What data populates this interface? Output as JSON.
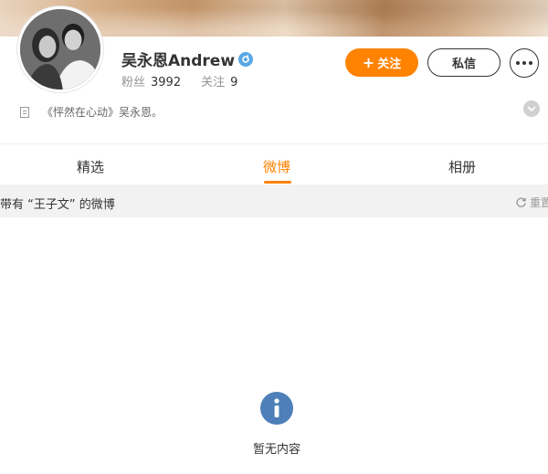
{
  "profile": {
    "name": "吴永恩Andrew",
    "followers_label": "粉丝",
    "followers_count": "3992",
    "following_label": "关注",
    "following_count": "9",
    "bio": "《怦然在心动》吴永恩。"
  },
  "actions": {
    "follow_label": "关注",
    "message_label": "私信"
  },
  "tabs": [
    {
      "label": "精选"
    },
    {
      "label": "微博",
      "active": true
    },
    {
      "label": "相册"
    }
  ],
  "filter": {
    "text": "带有 “王子文” 的微博",
    "reset_label": "重置"
  },
  "empty_state": {
    "text": "暂无内容"
  },
  "colors": {
    "accent": "#ff8200",
    "verified": "#5aa7e6",
    "info_icon": "#4d7fb8"
  }
}
